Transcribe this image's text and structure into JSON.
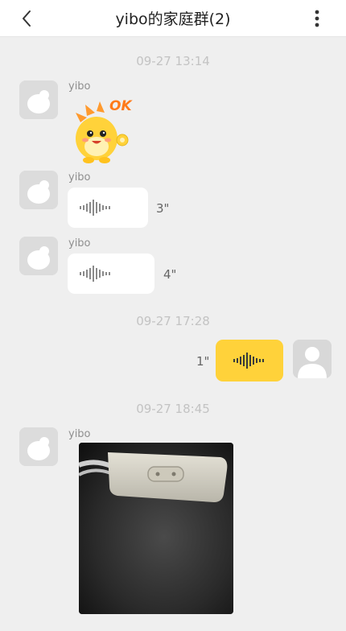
{
  "header": {
    "title": "yibo的家庭群(2)",
    "back_icon": "chevron-left-icon",
    "more_icon": "vertical-ellipsis-icon"
  },
  "messages": {
    "ts1": "09-27 13:14",
    "ts2": "09-27 17:28",
    "ts3": "09-27 18:45",
    "m1": {
      "sender": "yibo",
      "type": "sticker",
      "sticker_text": "OK"
    },
    "m2": {
      "sender": "yibo",
      "type": "voice",
      "duration": "3\""
    },
    "m3": {
      "sender": "yibo",
      "type": "voice",
      "duration": "4\""
    },
    "m4": {
      "sender": "me",
      "type": "voice",
      "duration": "1\""
    },
    "m5": {
      "sender": "yibo",
      "type": "image"
    }
  },
  "colors": {
    "own_bubble": "#ffd23a",
    "other_bubble": "#ffffff",
    "background": "#efefef"
  }
}
